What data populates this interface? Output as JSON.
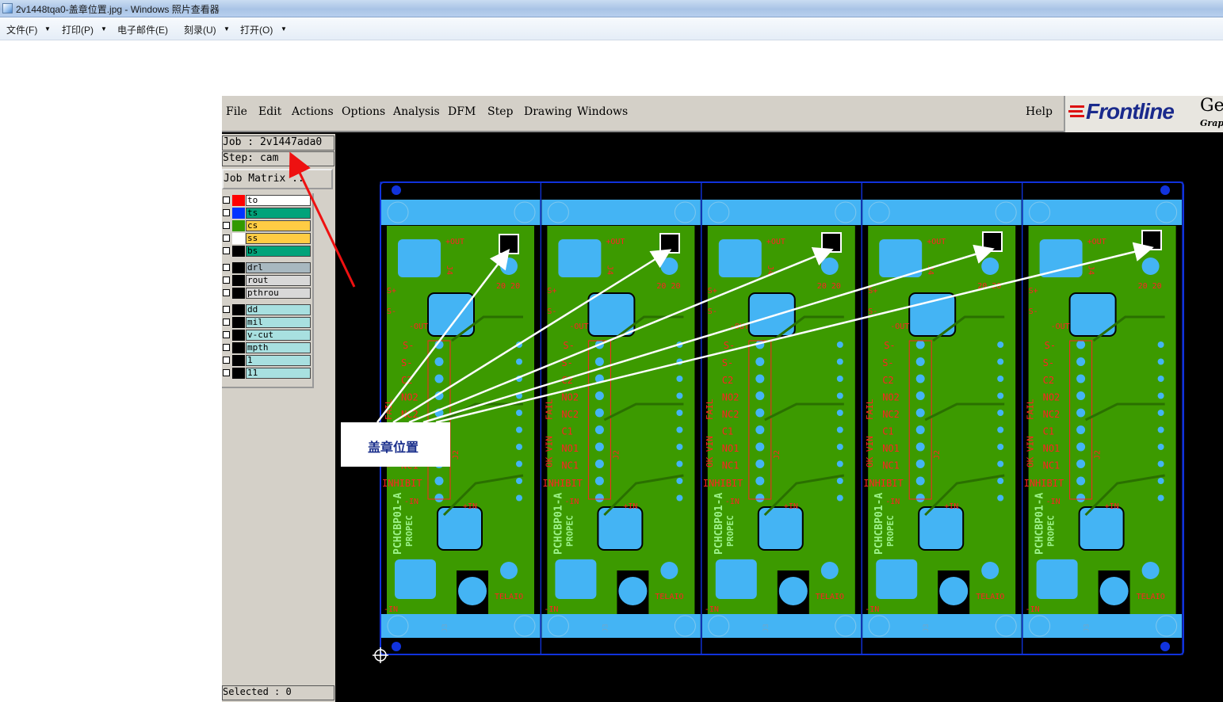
{
  "window": {
    "title": "2v1448tqa0-盖章位置.jpg - Windows 照片查看器",
    "icon": "photo-viewer-icon"
  },
  "viewer_menu": [
    {
      "label": "文件(F)",
      "has_arrow": true
    },
    {
      "label": "打印(P)",
      "has_arrow": true
    },
    {
      "label": "电子邮件(E)",
      "has_arrow": false
    },
    {
      "label": "刻录(U)",
      "has_arrow": true
    },
    {
      "label": "打开(O)",
      "has_arrow": true
    }
  ],
  "genesis": {
    "menu": [
      "File",
      "Edit",
      "Actions",
      "Options",
      "Analysis",
      "DFM",
      "Step",
      "Drawing",
      "Windows"
    ],
    "help": "Help",
    "logo": {
      "brand": "Frontline",
      "partial_word": "Ge",
      "partial_sub": "Grap"
    },
    "job_line": "Job : 2v1447ada0",
    "step_line": "Step: cam",
    "matrix_button": "Job Matrix ..",
    "selected_line": "Selected : 0",
    "layers": [
      {
        "name": "to",
        "swatch": "#ff0000",
        "bg": "#ffffff"
      },
      {
        "name": "ts",
        "swatch": "#0033ff",
        "bg": "#00a37a"
      },
      {
        "name": "cs",
        "swatch": "#339900",
        "bg": "#ffcc44"
      },
      {
        "name": "ss",
        "swatch": "#ffffff",
        "bg": "#ffcc44"
      },
      {
        "name": "bs",
        "swatch": "#000000",
        "bg": "#00a37a"
      },
      {
        "name": "drl",
        "swatch": "#000000",
        "bg": "#a8b8c0"
      },
      {
        "name": "rout",
        "swatch": "#000000",
        "bg": "#d8d8d8"
      },
      {
        "name": "pthrou",
        "swatch": "#000000",
        "bg": "#d8d8d8"
      },
      {
        "name": "dd",
        "swatch": "#000000",
        "bg": "#a8e0e0"
      },
      {
        "name": "mil",
        "swatch": "#000000",
        "bg": "#a8e0e0"
      },
      {
        "name": "v-cut",
        "swatch": "#000000",
        "bg": "#a8e0e0"
      },
      {
        "name": "mpth",
        "swatch": "#000000",
        "bg": "#a8e0e0"
      },
      {
        "name": "1",
        "swatch": "#000000",
        "bg": "#a8e0e0"
      },
      {
        "name": "11",
        "swatch": "#000000",
        "bg": "#a8e0e0"
      }
    ],
    "board": {
      "panel_count": 5,
      "silk_labels": {
        "out_pos": "+OUT",
        "out_neg": "-OUT",
        "s_pos": "S+",
        "s_neg": "S-",
        "telaio": "TELAIO",
        "in_neg": "-IN",
        "in_pos": "+IN",
        "inhibit": "INHIBIT",
        "pins": [
          "C2",
          "NO2",
          "NC2",
          "C1",
          "NO1",
          "NC1"
        ],
        "fail": "FAIL",
        "ok_vin": "OK VIN",
        "board_id": "PCHCBP01-A",
        "maker": "PROPEC",
        "j2": "J2",
        "j3": "J3",
        "j4": "J4",
        "num_20": "20 20"
      },
      "colors": {
        "green": "#3c9a00",
        "pad_blue": "#44b4f4",
        "outline_blue": "#1133dd",
        "silk_red": "#ff2222",
        "background": "#000000"
      }
    }
  },
  "annotation": {
    "label": "盖章位置",
    "arrow_color": "#ffffff",
    "pointer_color": "#ee1111"
  }
}
